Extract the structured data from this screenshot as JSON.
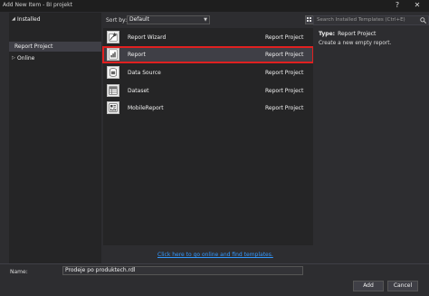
{
  "window": {
    "title": "Add New Item - BI projekt",
    "help": "?",
    "close": "✕"
  },
  "tree": {
    "installed": "Installed",
    "report_project": "Report Project",
    "online": "Online"
  },
  "sortbar": {
    "label": "Sort by:",
    "selected": "Default"
  },
  "search": {
    "placeholder": "Search Installed Templates (Ctrl+E)"
  },
  "templates": [
    {
      "name": "Report Wizard",
      "project": "Report Project",
      "icon": "report-wizard-icon"
    },
    {
      "name": "Report",
      "project": "Report Project",
      "icon": "report-icon"
    },
    {
      "name": "Data Source",
      "project": "Report Project",
      "icon": "data-source-icon"
    },
    {
      "name": "Dataset",
      "project": "Report Project",
      "icon": "dataset-icon"
    },
    {
      "name": "MobileReport",
      "project": "Report Project",
      "icon": "mobile-report-icon"
    }
  ],
  "details": {
    "type_label": "Type:",
    "type_value": "Report Project",
    "description": "Create a new empty report."
  },
  "online_link": "Click here to go online and find templates.",
  "name_field": {
    "label": "Name:",
    "value": "Prodeje po produktech.rdl"
  },
  "buttons": {
    "add": "Add",
    "cancel": "Cancel"
  },
  "colors": {
    "accent": "#007acc",
    "selection_border": "#e02020",
    "link": "#3399ff"
  }
}
